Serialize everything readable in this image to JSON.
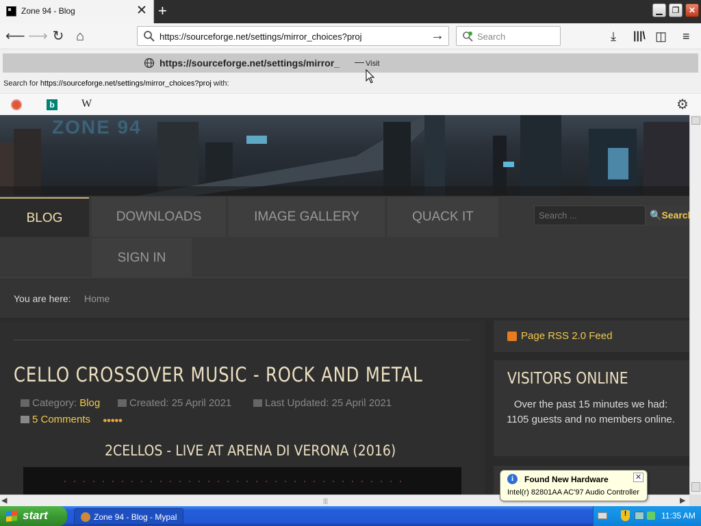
{
  "browser": {
    "tab_title": "Zone 94 - Blog",
    "url_text": "https://sourceforge.net/settings/mirror_choices?proj",
    "search_placeholder": "Search"
  },
  "dropdown": {
    "suggestion_url": "https://sourceforge.net/settings/mirror_",
    "suggestion_dash": "—",
    "suggestion_action": "Visit",
    "search_for_prefix": "Search for ",
    "search_for_url": "https://sourceforge.net/settings/mirror_choices?proj",
    "search_for_suffix": " with:",
    "engines": [
      "DuckDuckGo",
      "Bing",
      "Wikipedia"
    ]
  },
  "site": {
    "banner_logo": "ZONE 94",
    "menu": [
      "BLOG",
      "DOWNLOADS",
      "IMAGE GALLERY",
      "QUACK IT",
      "SIGN IN"
    ],
    "search_placeholder": "Search ...",
    "search_button": "Search",
    "breadcrumb_label": "You are here:",
    "breadcrumb_home": "Home",
    "article": {
      "title": "CELLO CROSSOVER MUSIC - ROCK AND METAL",
      "category_label": "Category:",
      "category": "Blog",
      "created": "Created: 25 April 2021",
      "updated": "Last Updated: 25 April 2021",
      "comments": "5 Comments",
      "rating_stars": 5,
      "subtitle": "2CELLOS - LIVE AT ARENA DI VERONA (2016)"
    },
    "sidebar": {
      "rss": "Page RSS 2.0 Feed",
      "visitors_title": "VISITORS ONLINE",
      "visitors_text": "Over the past 15 minutes we had: 1105 guests and no members online."
    }
  },
  "balloon": {
    "title": "Found New Hardware",
    "text": "Intel(r) 82801AA AC'97 Audio Controller"
  },
  "taskbar": {
    "start": "start",
    "task": "Zone 94 - Blog - Mypal",
    "clock": "11:35 AM"
  },
  "colors": {
    "accent_gold": "#f2c94c",
    "heading_cream": "#ede0c2",
    "xp_blue": "#245edb",
    "xp_green": "#3a9a32"
  }
}
